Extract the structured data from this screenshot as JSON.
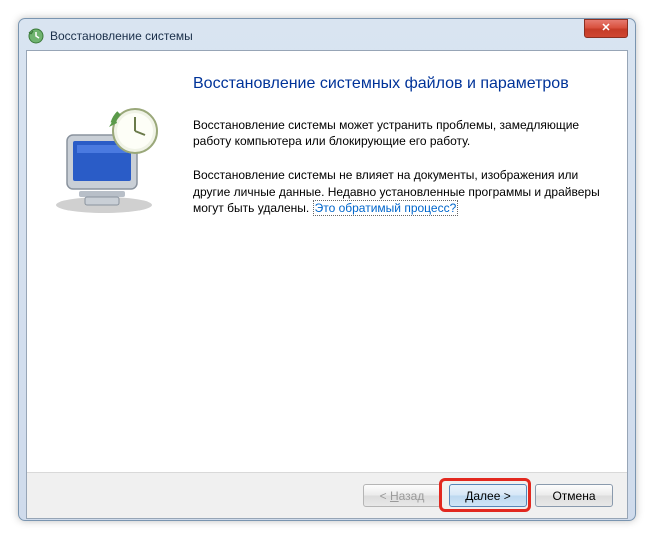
{
  "window": {
    "title": "Восстановление системы"
  },
  "content": {
    "heading": "Восстановление системных файлов и параметров",
    "para1": "Восстановление системы может устранить проблемы, замедляющие работу компьютера или блокирующие его работу.",
    "para2_pre": "Восстановление системы не влияет на документы, изображения или другие личные данные. Недавно установленные программы и драйверы могут быть удалены. ",
    "para2_link": "Это обратимый процесс?"
  },
  "buttons": {
    "back_prefix": "< ",
    "back_u": "Н",
    "back_suffix": "азад",
    "next_u": "Д",
    "next_suffix": "алее >",
    "cancel": "Отмена"
  }
}
